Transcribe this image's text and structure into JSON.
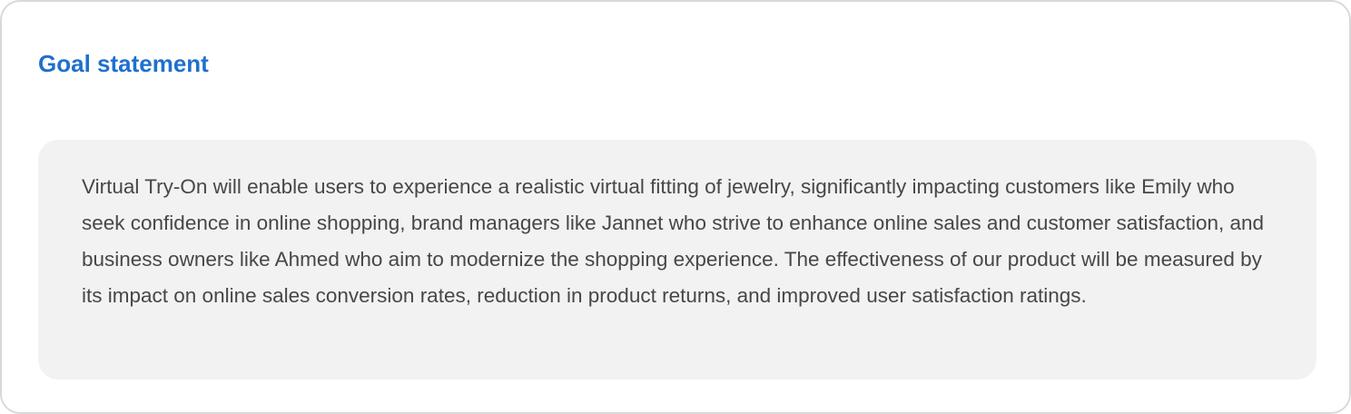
{
  "section": {
    "title": "Goal statement",
    "body": "Virtual Try-On will enable users to experience a realistic virtual fitting of jewelry, significantly impacting customers like Emily who seek confidence in online shopping, brand managers like Jannet who strive to enhance online sales and customer satisfaction, and business owners like Ahmed who aim to modernize the shopping experience. The effectiveness of our product will be measured by its impact on online sales conversion rates, reduction in product returns, and improved user satisfaction ratings."
  },
  "colors": {
    "title": "#1f6fcf",
    "body_text": "#474747",
    "panel_background": "#f2f2f2",
    "card_border": "#d9d9d9"
  }
}
